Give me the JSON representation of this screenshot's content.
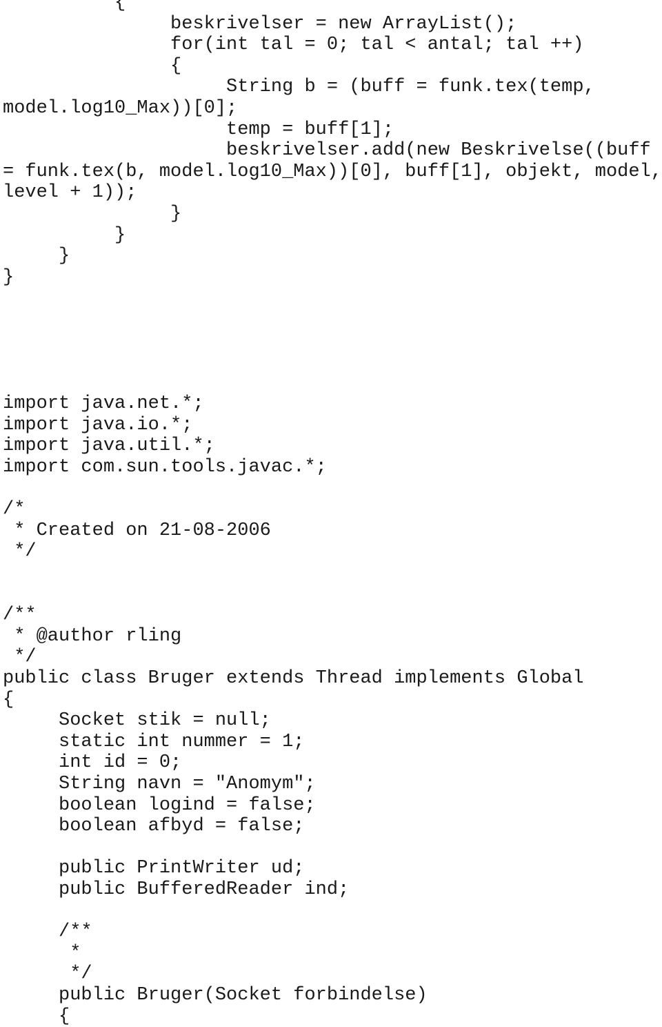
{
  "document": {
    "kind": "source-code-listing",
    "language": "Java",
    "background_color": "#ffffff",
    "text_color": "#1a1a1a"
  },
  "code": {
    "lines": [
      "          {",
      "               beskrivelser = new ArrayList();",
      "               for(int tal = 0; tal < antal; tal ++)",
      "               {",
      "                    String b = (buff = funk.tex(temp,",
      "model.log10_Max))[0];",
      "                    temp = buff[1];",
      "                    beskrivelser.add(new Beskrivelse((buff",
      "= funk.tex(b, model.log10_Max))[0], buff[1], objekt, model,",
      "level + 1));",
      "               }",
      "          }",
      "     }",
      "}",
      "",
      "",
      "",
      "",
      "",
      "import java.net.*;",
      "import java.io.*;",
      "import java.util.*;",
      "import com.sun.tools.javac.*;",
      "",
      "/*",
      " * Created on 21-08-2006",
      " */",
      "",
      "",
      "/**",
      " * @author rling",
      " */",
      "public class Bruger extends Thread implements Global",
      "{",
      "     Socket stik = null;",
      "     static int nummer = 1;",
      "     int id = 0;",
      "     String navn = \"Anomym\";",
      "     boolean logind = false;",
      "     boolean afbyd = false;",
      "",
      "     public PrintWriter ud;",
      "     public BufferedReader ind;",
      "",
      "     /**",
      "      *",
      "      */",
      "     public Bruger(Socket forbindelse)",
      "     {"
    ]
  }
}
